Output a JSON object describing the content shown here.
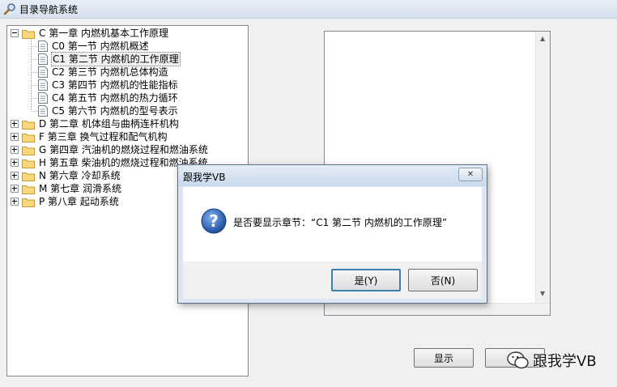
{
  "window": {
    "title": "目录导航系统"
  },
  "tree": {
    "nodes": [
      {
        "label": "C 第一章 内燃机基本工作原理",
        "type": "folder",
        "expanded": true,
        "level": 0
      },
      {
        "label": "C0 第一节 内燃机概述",
        "type": "doc",
        "level": 1
      },
      {
        "label": "C1 第二节 内燃机的工作原理",
        "type": "doc",
        "level": 1,
        "selected": true
      },
      {
        "label": "C2 第三节 内燃机总体构造",
        "type": "doc",
        "level": 1
      },
      {
        "label": "C3 第四节 内燃机的性能指标",
        "type": "doc",
        "level": 1
      },
      {
        "label": "C4 第五节 内燃机的热力循环",
        "type": "doc",
        "level": 1
      },
      {
        "label": "C5 第六节 内燃机的型号表示",
        "type": "doc",
        "level": 1
      },
      {
        "label": "D 第二章 机体组与曲柄连杆机构",
        "type": "folder",
        "expanded": false,
        "level": 0
      },
      {
        "label": "F 第三章 换气过程和配气机构",
        "type": "folder",
        "expanded": false,
        "level": 0
      },
      {
        "label": "G 第四章 汽油机的燃烧过程和燃油系统",
        "type": "folder",
        "expanded": false,
        "level": 0
      },
      {
        "label": "H 第五章 柴油机的燃烧过程和燃油系统",
        "type": "folder",
        "expanded": false,
        "level": 0
      },
      {
        "label": "N 第六章 冷却系统",
        "type": "folder",
        "expanded": false,
        "level": 0
      },
      {
        "label": "M 第七章 润滑系统",
        "type": "folder",
        "expanded": false,
        "level": 0
      },
      {
        "label": "P 第八章 起动系统",
        "type": "folder",
        "expanded": false,
        "level": 0
      }
    ]
  },
  "buttons": {
    "show_label": "显示"
  },
  "watermark": {
    "text": "跟我学VB"
  },
  "dialog": {
    "title": "跟我学VB",
    "message": "是否要显示章节：“C1 第二节 内燃机的工作原理”",
    "yes_label": "是(Y)",
    "no_label": "否(N)",
    "icon": "question-icon"
  },
  "colors": {
    "selection": "#f0f0f0",
    "dialog_frame": "#dce7f3",
    "question_icon": "#2a5fb0"
  }
}
